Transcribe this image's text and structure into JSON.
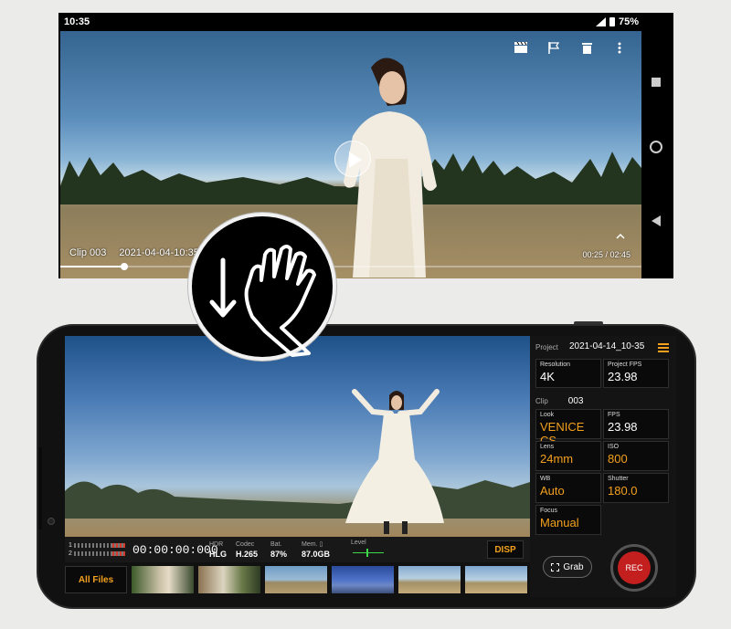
{
  "playback": {
    "status_time": "10:35",
    "battery": "75%",
    "clip_name": "Clip 003",
    "clip_datetime": "2021-04-04-10:35",
    "position": "00:25 / 02:45",
    "progress": 0.11,
    "actions": [
      "clapper-icon",
      "flag-icon",
      "trash-icon",
      "more-vert-icon"
    ]
  },
  "gesture": {
    "icon": "swipe-down-hand-icon"
  },
  "camera": {
    "project_label": "Project",
    "project_value": "2021-04-14_10-35",
    "resolution_label": "Resolution",
    "resolution_value": "4K",
    "project_fps_label": "Project FPS",
    "project_fps_value": "23.98",
    "clip_label": "Clip",
    "clip_value": "003",
    "look_label": "Look",
    "look_value": "VENICE CS",
    "fps_label": "FPS",
    "fps_value": "23.98",
    "lens_label": "Lens",
    "lens_value": "24mm",
    "iso_label": "ISO",
    "iso_value": "800",
    "wb_label": "WB",
    "wb_value": "Auto",
    "shutter_label": "Shutter",
    "shutter_value": "180.0",
    "focus_label": "Focus",
    "focus_value": "Manual",
    "timecode": "00:00:00:000",
    "hdr_label": "HDR",
    "hdr_value": "HLG",
    "codec_label": "Codec",
    "codec_value": "H.265",
    "bat_label": "Bat.",
    "bat_value": "87%",
    "mem_label": "Mem. ▯",
    "mem_value": "87.0GB",
    "level_label": "Level",
    "meter_ch1": "1",
    "meter_ch2": "2",
    "disp_label": "DISP",
    "all_files_label": "All Files",
    "grab_label": "Grab",
    "rec_label": "REC",
    "accent_color": "#f3a11d",
    "rec_color": "#c41f1f"
  }
}
